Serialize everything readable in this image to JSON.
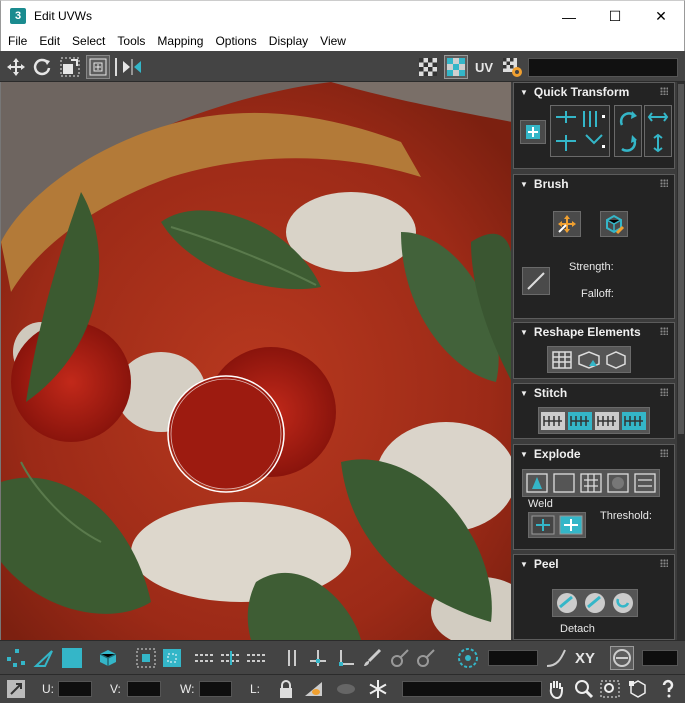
{
  "window": {
    "app_icon_glyph": "3",
    "title": "Edit UVWs",
    "minimize_glyph": "—",
    "maximize_glyph": "☐",
    "close_glyph": "✕"
  },
  "menu": [
    "File",
    "Edit",
    "Select",
    "Tools",
    "Mapping",
    "Options",
    "Display",
    "View"
  ],
  "top_toolbar": {
    "uv_label": "UV",
    "icons": [
      "move-icon",
      "rotate-icon",
      "scale-icon",
      "freeform-icon",
      "mirror-icon",
      "checker-icon",
      "texture-toggle-icon",
      "uv-dropdown-icon",
      "settings-icon"
    ]
  },
  "panel": {
    "quick_transform": {
      "title": "Quick Transform"
    },
    "brush": {
      "title": "Brush",
      "strength_label": "Strength:",
      "falloff_label": "Falloff:"
    },
    "reshape": {
      "title": "Reshape Elements"
    },
    "stitch": {
      "title": "Stitch"
    },
    "explode": {
      "title": "Explode",
      "weld_label": "Weld",
      "threshold_label": "Threshold:"
    },
    "peel": {
      "title": "Peel",
      "detach_label": "Detach"
    }
  },
  "bottom_toolbar": {
    "xy_label": "XY",
    "u_label": "U:",
    "v_label": "V:",
    "w_label": "W:",
    "l_label": "L:"
  },
  "colors": {
    "toolbar_bg": "#444444",
    "panel_bg": "#3c3c3c",
    "rollout_bg": "#232323",
    "accent_cyan": "#34b6c8",
    "title_bar": "#ffffff"
  }
}
